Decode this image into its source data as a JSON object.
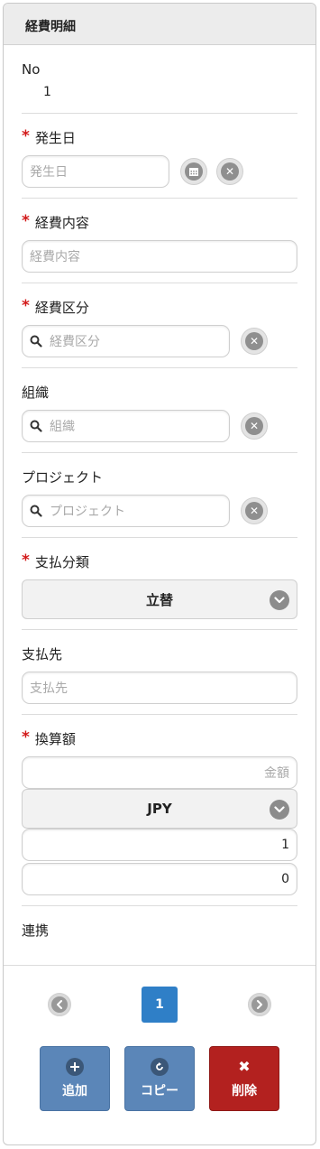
{
  "header": {
    "title": "経費明細"
  },
  "fields": {
    "no": {
      "label": "No",
      "value": "1"
    },
    "occurrence_date": {
      "label": "発生日",
      "placeholder": "発生日"
    },
    "expense_content": {
      "label": "経費内容",
      "placeholder": "経費内容"
    },
    "expense_category": {
      "label": "経費区分",
      "placeholder": "経費区分"
    },
    "organization": {
      "label": "組織",
      "placeholder": "組織"
    },
    "project": {
      "label": "プロジェクト",
      "placeholder": "プロジェクト"
    },
    "payment_type": {
      "label": "支払分類",
      "selected": "立替"
    },
    "payee": {
      "label": "支払先",
      "placeholder": "支払先"
    },
    "converted_amount": {
      "label": "換算額",
      "amount_placeholder": "金額",
      "currency": "JPY",
      "rate": "1",
      "result": "0"
    },
    "link": {
      "label": "連携"
    }
  },
  "required_mark": "*",
  "pager": {
    "current_page": "1"
  },
  "actions": {
    "add_label": "追加",
    "copy_label": "コピー",
    "delete_label": "削除"
  },
  "colors": {
    "required": "#d21a1a",
    "page_active": "#2f7fc7",
    "button_blue": "#5b86b8",
    "button_red": "#b3211f"
  }
}
